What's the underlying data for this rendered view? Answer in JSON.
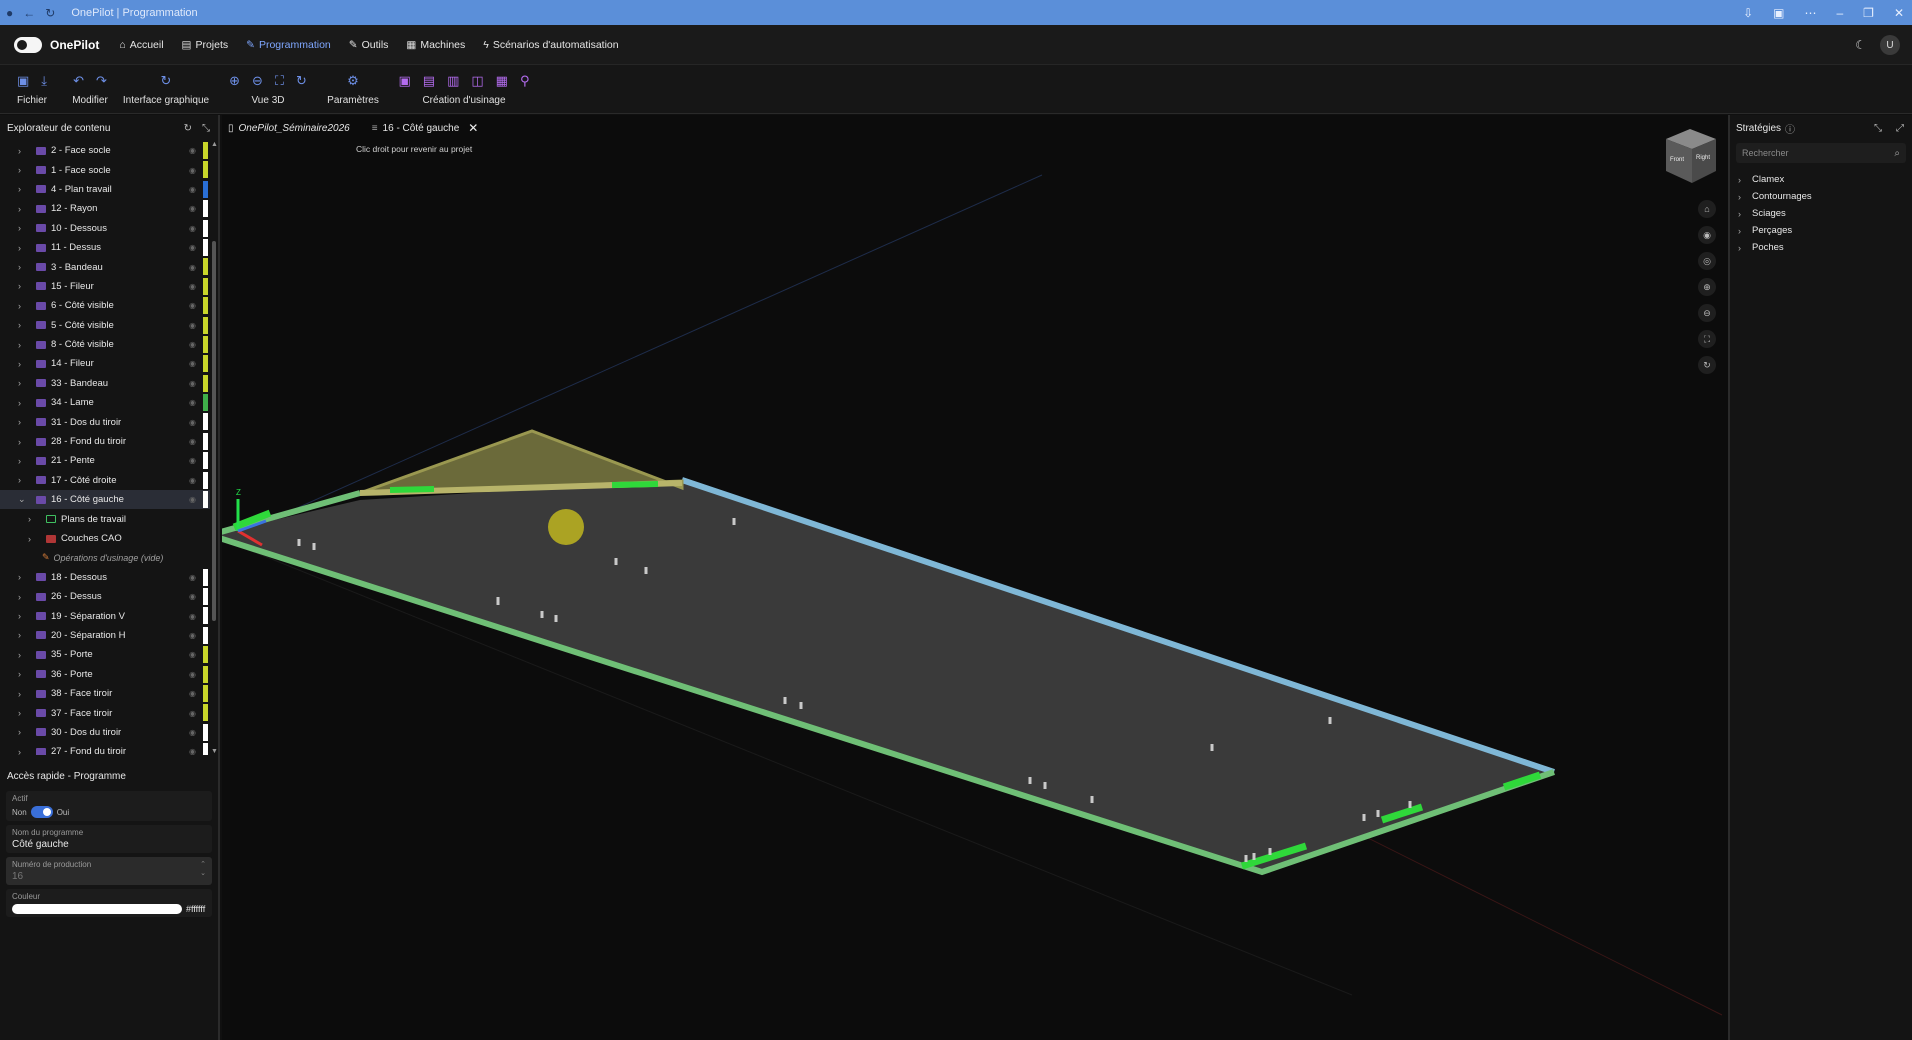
{
  "window": {
    "title": "OnePilot | Programmation"
  },
  "nav": {
    "brand": "OnePilot",
    "items": [
      {
        "label": "Accueil",
        "icon": "home-icon",
        "active": false
      },
      {
        "label": "Projets",
        "icon": "folder-icon",
        "active": false
      },
      {
        "label": "Programmation",
        "icon": "pencil-icon",
        "active": true
      },
      {
        "label": "Outils",
        "icon": "wrench-icon",
        "active": false
      },
      {
        "label": "Machines",
        "icon": "machine-icon",
        "active": false
      },
      {
        "label": "Scénarios d'automatisation",
        "icon": "bolt-icon",
        "active": false
      }
    ],
    "user_initial": "U"
  },
  "toolbar": {
    "groups": [
      {
        "label": "Fichier"
      },
      {
        "label": "Modifier"
      },
      {
        "label": "Interface graphique"
      },
      {
        "label": "Vue 3D"
      },
      {
        "label": "Paramètres"
      },
      {
        "label": "Création d'usinage"
      }
    ]
  },
  "explorer": {
    "title": "Explorateur de contenu",
    "items": [
      {
        "label": "2 - Face socle",
        "color": "#c8d62a"
      },
      {
        "label": "1 - Face socle",
        "color": "#c8d62a"
      },
      {
        "label": "4 - Plan travail",
        "color": "#2a6fd6"
      },
      {
        "label": "12 - Rayon",
        "color": "#ffffff"
      },
      {
        "label": "10 - Dessous",
        "color": "#ffffff"
      },
      {
        "label": "11 - Dessus",
        "color": "#ffffff"
      },
      {
        "label": "3 - Bandeau",
        "color": "#c8d62a"
      },
      {
        "label": "15 - Fileur",
        "color": "#c8d62a"
      },
      {
        "label": "6 - Côté visible",
        "color": "#c8d62a"
      },
      {
        "label": "5 - Côté visible",
        "color": "#c8d62a"
      },
      {
        "label": "8 - Côté visible",
        "color": "#c8d62a"
      },
      {
        "label": "14 - Fileur",
        "color": "#c8d62a"
      },
      {
        "label": "33 - Bandeau",
        "color": "#c8d62a"
      },
      {
        "label": "34 - Lame",
        "color": "#3fb04a"
      },
      {
        "label": "31 - Dos du tiroir",
        "color": "#ffffff"
      },
      {
        "label": "28 - Fond du tiroir",
        "color": "#ffffff"
      },
      {
        "label": "21 - Pente",
        "color": "#ffffff"
      },
      {
        "label": "17 - Côté droite",
        "color": "#ffffff"
      },
      {
        "label": "16 - Côté gauche",
        "color": "#ffffff",
        "selected": true
      },
      {
        "label": "18 - Dessous",
        "color": "#ffffff"
      },
      {
        "label": "26 - Dessus",
        "color": "#ffffff"
      },
      {
        "label": "19 - Séparation V",
        "color": "#ffffff"
      },
      {
        "label": "20 - Séparation H",
        "color": "#ffffff"
      },
      {
        "label": "35 - Porte",
        "color": "#c8d62a"
      },
      {
        "label": "36 - Porte",
        "color": "#c8d62a"
      },
      {
        "label": "38 - Face tiroir",
        "color": "#c8d62a"
      },
      {
        "label": "37 - Face tiroir",
        "color": "#c8d62a"
      },
      {
        "label": "30 - Dos du tiroir",
        "color": "#ffffff"
      },
      {
        "label": "27 - Fond du tiroir",
        "color": "#ffffff"
      }
    ],
    "children": {
      "plans": "Plans de travail",
      "cad": "Couches CAO",
      "ops": "Opérations d'usinage (vide)"
    }
  },
  "quick_access": {
    "title": "Accès rapide - Programme",
    "actif_label": "Actif",
    "off_label": "Non",
    "on_label": "Oui",
    "name_label": "Nom du programme",
    "name_value": "Côté gauche",
    "prod_label": "Numéro de production",
    "prod_value": "16",
    "color_label": "Couleur",
    "color_value": "#ffffff"
  },
  "tabs": [
    {
      "label": "OnePilot_Séminaire2026",
      "active": false
    },
    {
      "label": "16 - Côté gauche",
      "active": true
    }
  ],
  "hint": "Clic droit pour revenir au projet",
  "viewcube": {
    "front": "Front",
    "right": "Right"
  },
  "axis": {
    "z": "Z"
  },
  "strategies": {
    "title": "Stratégies",
    "search_placeholder": "Rechercher",
    "items": [
      "Clamex",
      "Contournages",
      "Sciages",
      "Perçages",
      "Poches"
    ]
  }
}
